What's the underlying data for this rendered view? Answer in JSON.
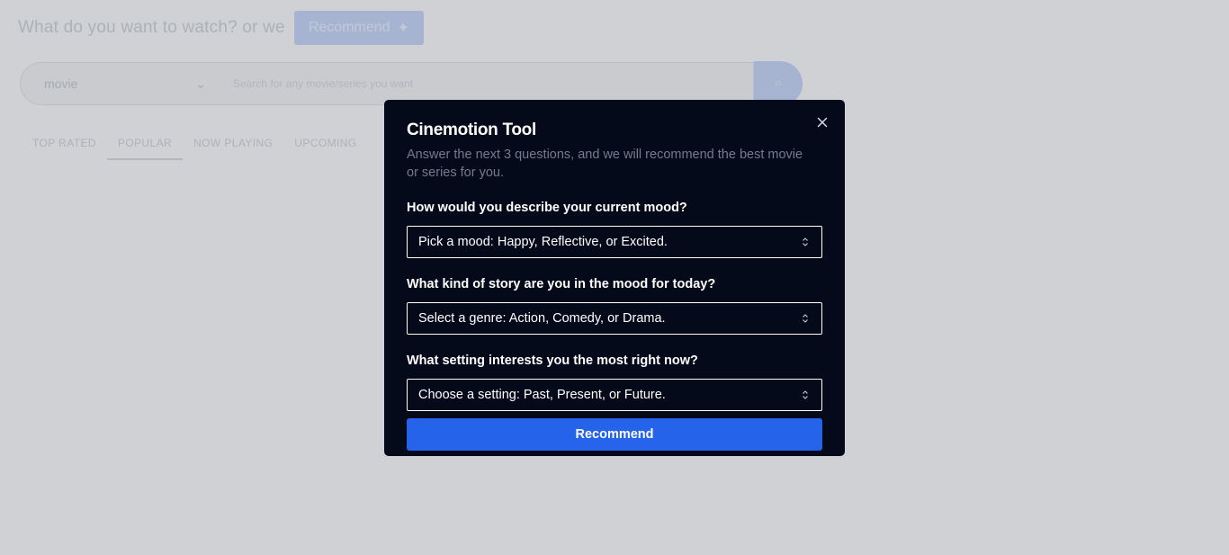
{
  "background": {
    "prompt": "What do you want to watch? or we",
    "recommend_label": "Recommend",
    "search": {
      "category": "movie",
      "placeholder": "Search for any movie/series you want"
    },
    "tabs": [
      {
        "label": "TOP RATED"
      },
      {
        "label": "POPULAR",
        "active": true
      },
      {
        "label": "NOW PLAYING"
      },
      {
        "label": "UPCOMING"
      }
    ]
  },
  "modal": {
    "title": "Cinemotion Tool",
    "description": "Answer the next 3 questions, and we will recommend the best movie or series for you.",
    "questions": [
      {
        "label": "How would you describe your current mood?",
        "selected": "Pick a mood: Happy, Reflective, or Excited."
      },
      {
        "label": "What kind of story are you in the mood for today?",
        "selected": "Select a genre: Action, Comedy, or Drama."
      },
      {
        "label": "What setting interests you the most right now?",
        "selected": "Choose a setting: Past, Present, or Future."
      }
    ],
    "submit_label": "Recommend"
  },
  "icons": {
    "close": "close-icon",
    "select_chevron": "chevron-up-down-icon",
    "search": "search-icon"
  },
  "colors": {
    "modal_background": "#040a19",
    "accent": "#2563eb",
    "muted_text": "#737b8c"
  }
}
